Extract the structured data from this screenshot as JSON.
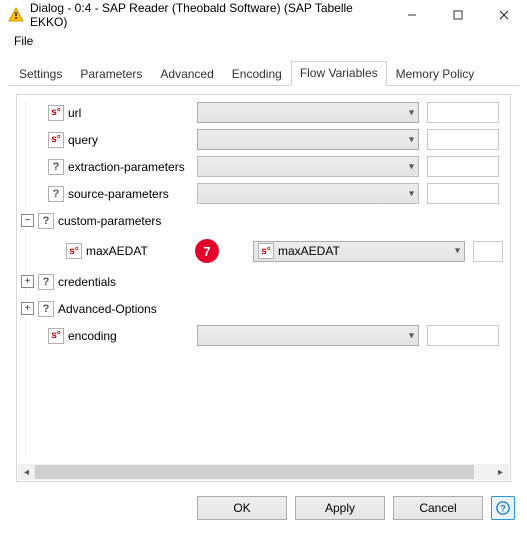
{
  "title": "Dialog - 0:4 - SAP Reader (Theobald Software) (SAP Tabelle EKKO)",
  "menu": {
    "file": "File"
  },
  "tabs": {
    "settings": "Settings",
    "parameters": "Parameters",
    "advanced": "Advanced",
    "encoding": "Encoding",
    "flowvars": "Flow Variables",
    "memory": "Memory Policy",
    "active": "flowvars"
  },
  "tree": {
    "url": {
      "label": "url",
      "icon": "s"
    },
    "query": {
      "label": "query",
      "icon": "s"
    },
    "extraction_params": {
      "label": "extraction-parameters",
      "icon": "q"
    },
    "source_params": {
      "label": "source-parameters",
      "icon": "q"
    },
    "custom_params": {
      "label": "custom-parameters",
      "icon": "q",
      "expander": "−"
    },
    "max_aedat": {
      "label": "maxAEDAT",
      "icon": "s"
    },
    "credentials": {
      "label": "credentials",
      "icon": "q",
      "expander": "+"
    },
    "advanced_opts": {
      "label": "Advanced-Options",
      "icon": "q",
      "expander": "+"
    },
    "encoding": {
      "label": "encoding",
      "icon": "s"
    }
  },
  "combo": {
    "max_aedat_value": "maxAEDAT"
  },
  "annotation": {
    "seven": "7"
  },
  "buttons": {
    "ok": "OK",
    "apply": "Apply",
    "cancel": "Cancel"
  },
  "icon_glyphs": {
    "s": "s°",
    "q": "?"
  }
}
